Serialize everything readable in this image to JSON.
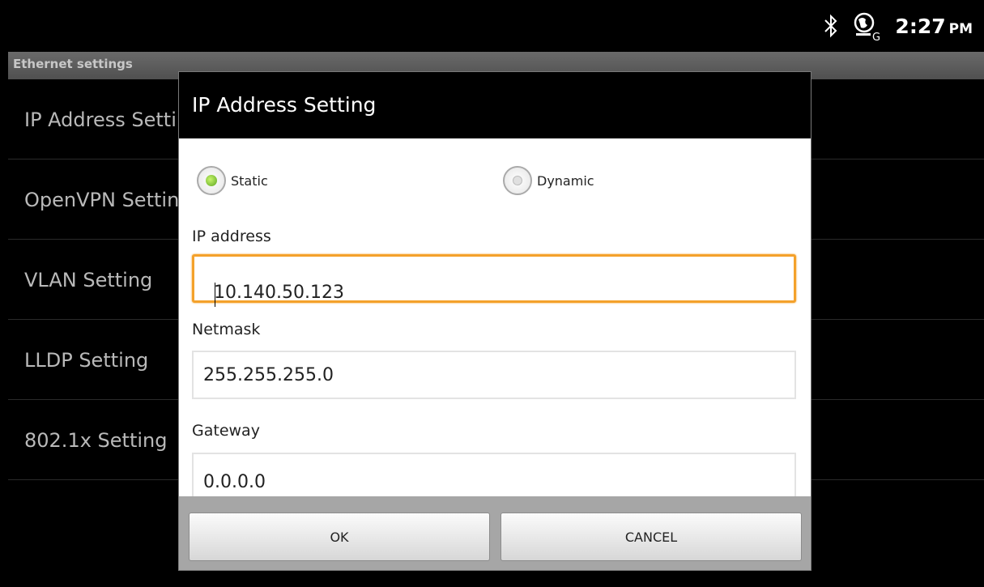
{
  "status_bar": {
    "bluetooth_icon": "bluetooth-icon",
    "network_icon": "globe-g-icon",
    "time": "2:27",
    "ampm": "PM"
  },
  "background": {
    "header": "Ethernet settings",
    "items": [
      {
        "label": "IP Address Setting"
      },
      {
        "label": "OpenVPN Setting"
      },
      {
        "label": "VLAN Setting"
      },
      {
        "label": "LLDP Setting"
      },
      {
        "label": "802.1x Setting"
      }
    ]
  },
  "dialog": {
    "title": "IP Address Setting",
    "mode_options": {
      "static_label": "Static",
      "dynamic_label": "Dynamic",
      "selected": "Static"
    },
    "fields": {
      "ip_label": "IP address",
      "ip_value": "10.140.50.123",
      "netmask_label": "Netmask",
      "netmask_value": "255.255.255.0",
      "gateway_label": "Gateway",
      "gateway_value": "0.0.0.0"
    },
    "buttons": {
      "ok": "OK",
      "cancel": "CANCEL"
    }
  },
  "colors": {
    "focus_accent": "#f4a12b",
    "radio_selected": "#5ca621"
  }
}
